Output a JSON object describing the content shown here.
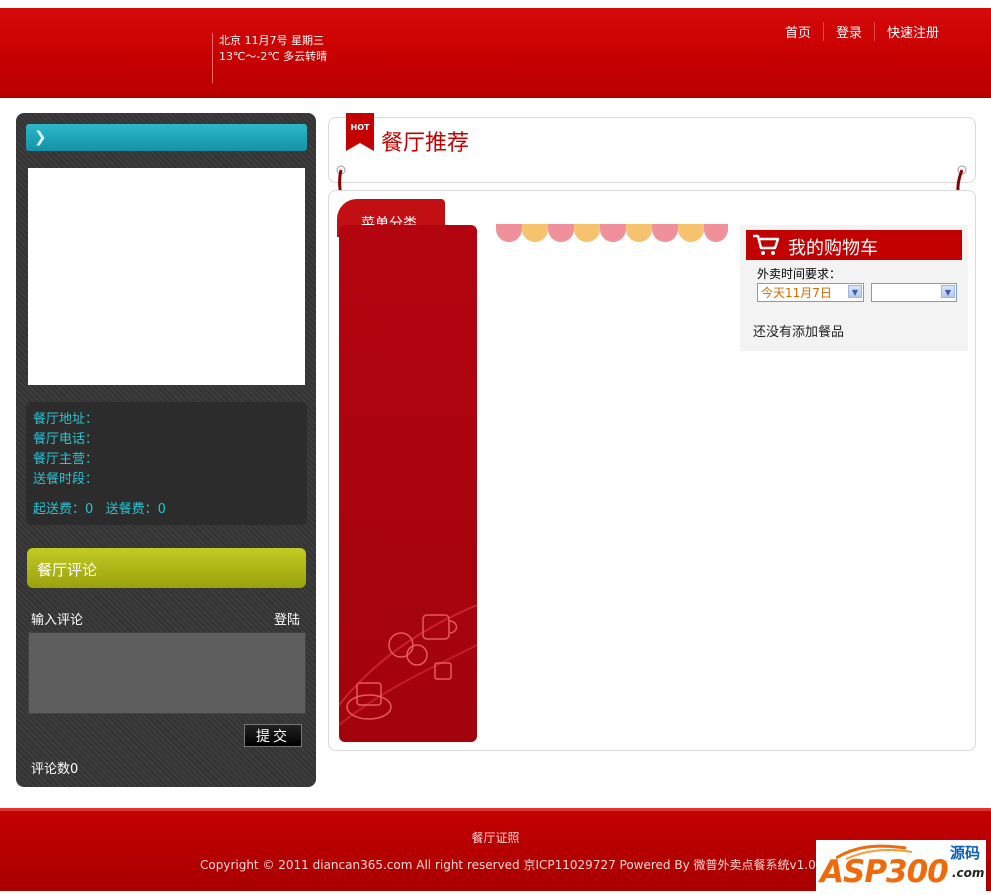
{
  "header": {
    "weather_line1": "北京 11月7号 星期三",
    "weather_line2": "13℃～-2℃ 多云转晴",
    "nav": [
      "首页",
      "登录",
      "快速注册"
    ]
  },
  "sidebar": {
    "address_label": "餐厅地址：",
    "phone_label": "餐厅电话：",
    "main_label": "餐厅主营：",
    "delivery_time_label": "送餐时段：",
    "fees": "起送费：0   送餐费：0"
  },
  "review": {
    "title": "餐厅评论",
    "input_label": "输入评论",
    "login": "登陆",
    "submit": "提交",
    "count": "评论数0"
  },
  "recommend": {
    "hot": "HOT",
    "title": "餐厅推荐"
  },
  "menu": {
    "tab_label": "菜单分类"
  },
  "cart": {
    "title": "我的购物车",
    "time_label": "外卖时间要求：",
    "date_select": "今天11月7日",
    "time_select": "",
    "empty": "还没有添加餐品"
  },
  "footer": {
    "license": "餐厅证照",
    "copyright": "Copyright © 2011 diancan365.com All right reserved 京ICP11029727 Powered By 微普外卖点餐系统v1.0"
  },
  "logo": {
    "text": "ASP300",
    "source": "源码",
    "com": ".com"
  },
  "colors": {
    "brand_red": "#c40000",
    "teal": "#28c3d3",
    "olive": "#aab116"
  },
  "icons": {
    "chevron": "chevron-right-icon",
    "cart": "shopping-cart-icon",
    "dropdown": "chevron-down-icon"
  }
}
